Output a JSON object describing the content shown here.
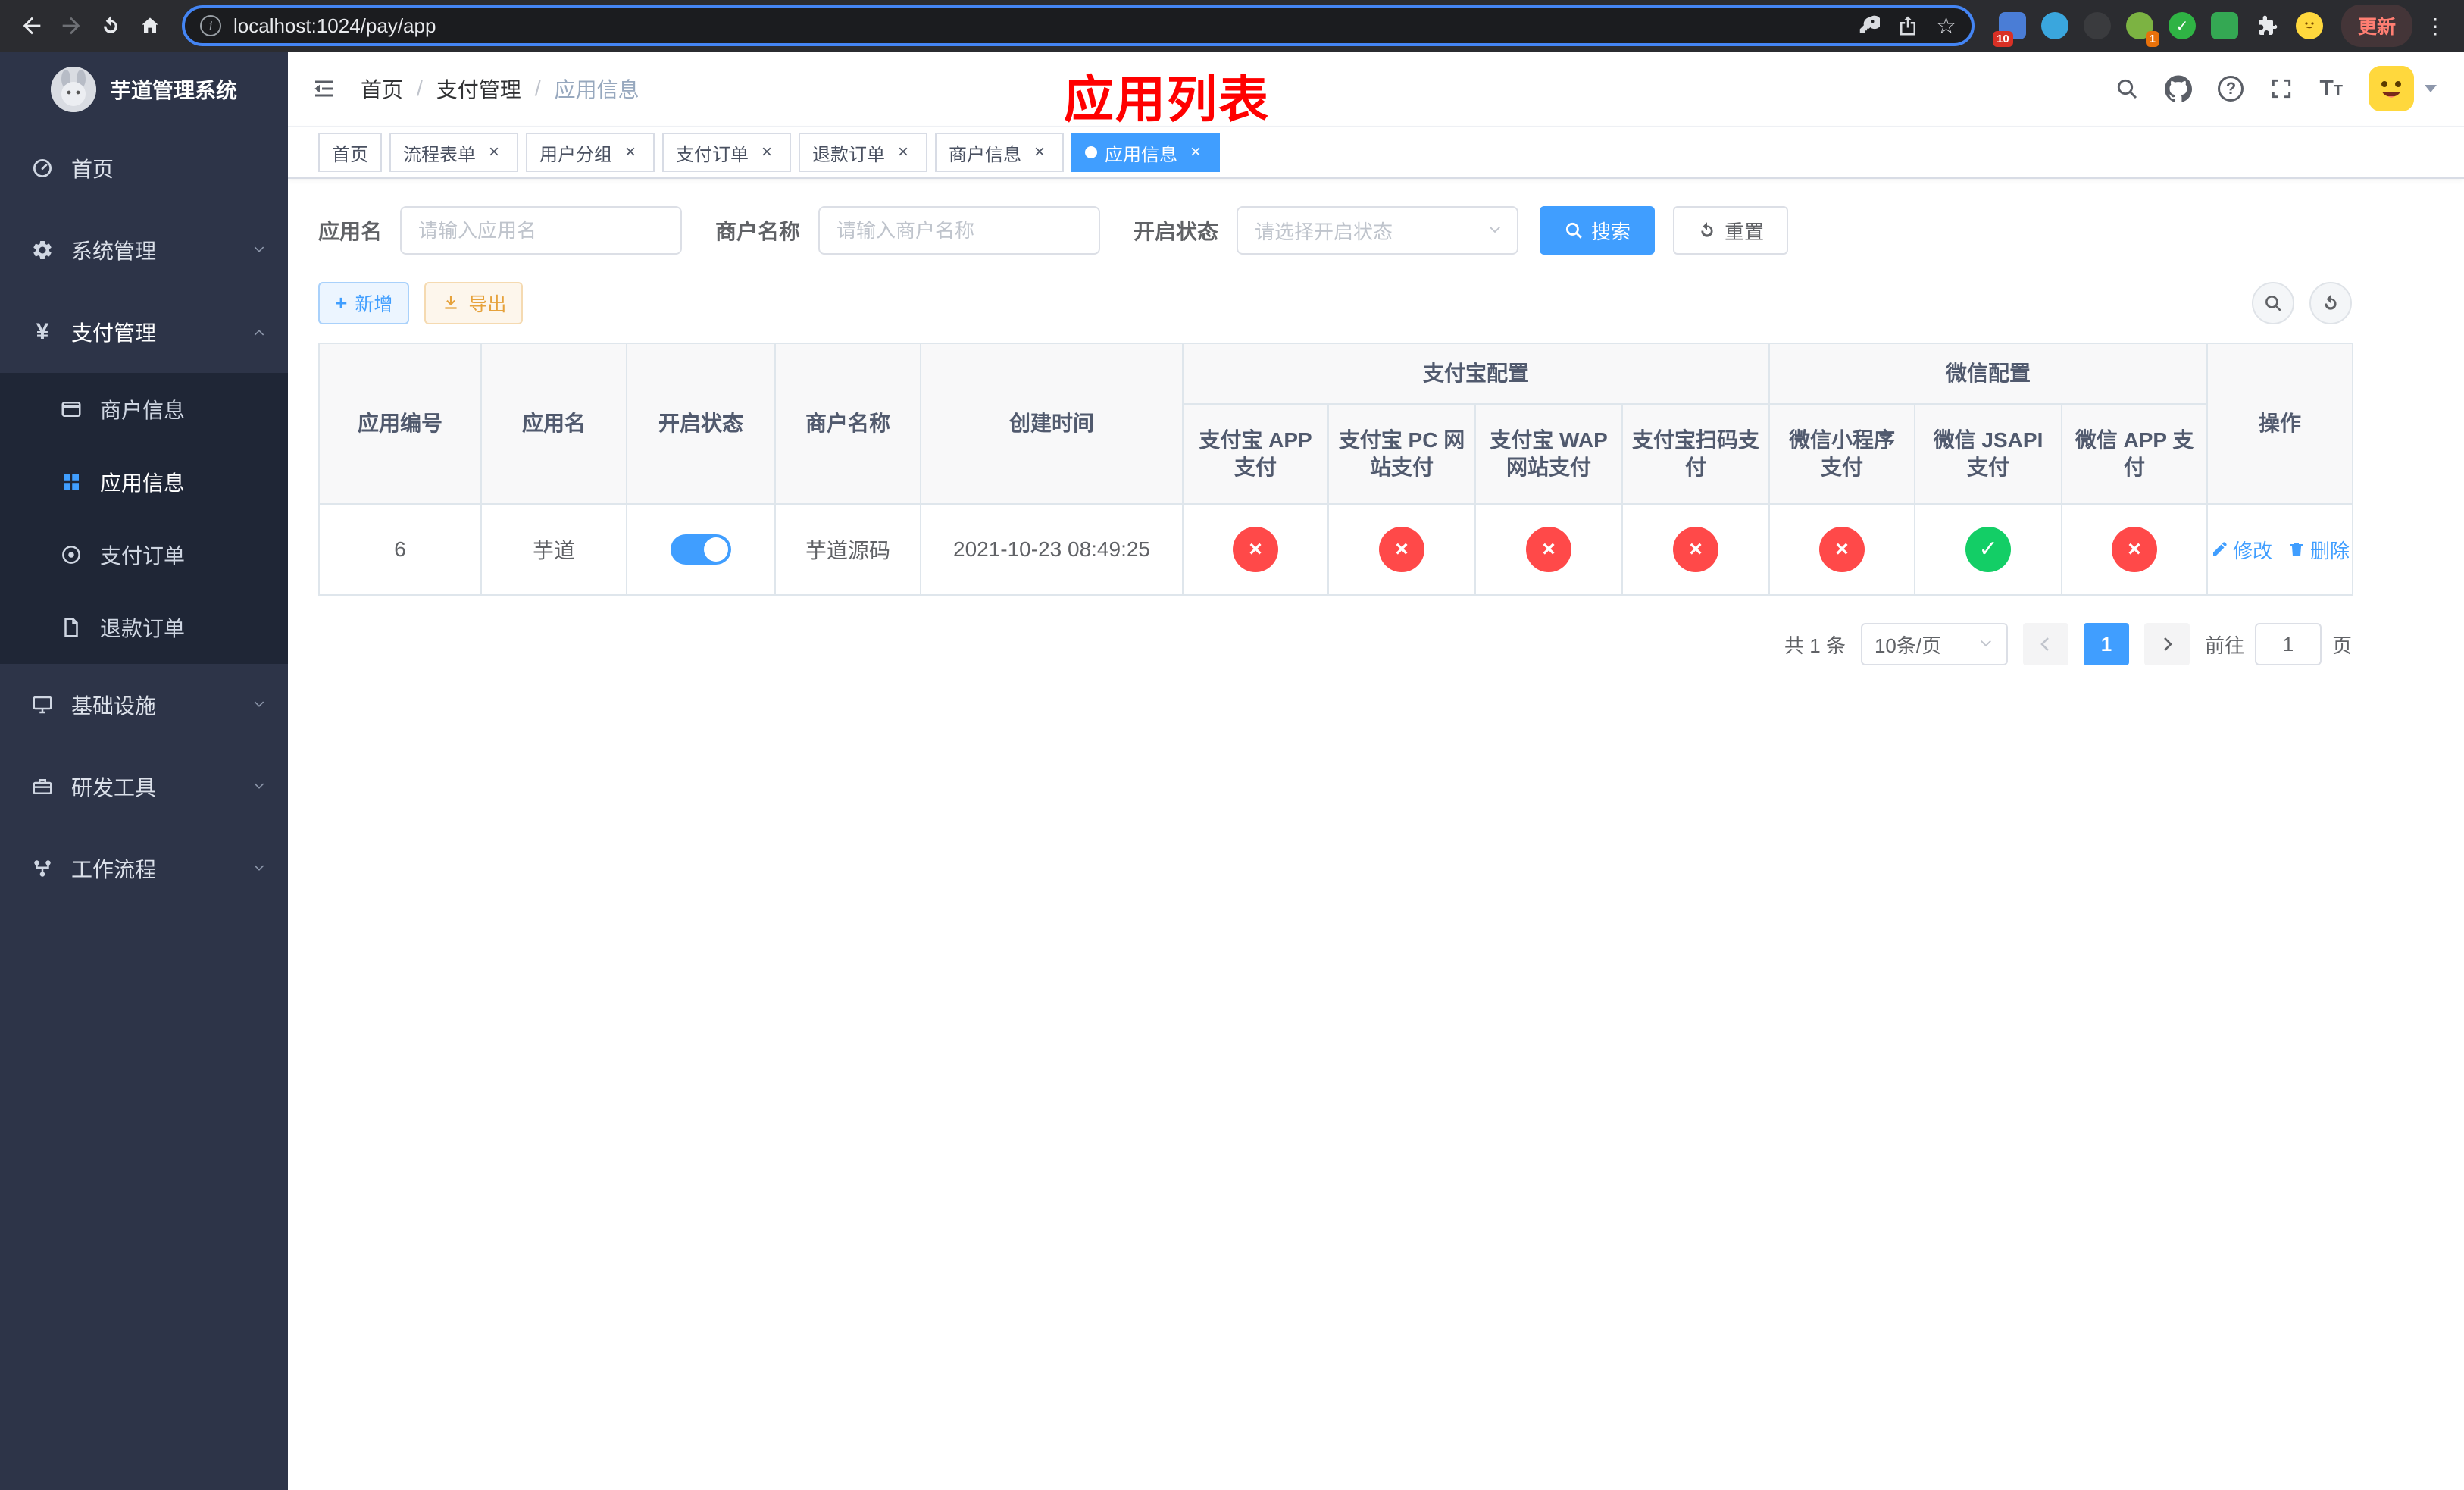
{
  "browser": {
    "url": "localhost:1024/pay/app",
    "update_label": "更新",
    "badge_apps": "10",
    "badge_avatar": "1"
  },
  "icons": {
    "close": "×",
    "cross": "×",
    "check": "✓",
    "plus": "+",
    "dots_vertical": "⋮",
    "star": "☆",
    "info": "i",
    "question": "?",
    "yen": "¥",
    "font_big": "T",
    "font_small": "T"
  },
  "sidebar": {
    "title": "芋道管理系统",
    "items": [
      {
        "label": "首页"
      },
      {
        "label": "系统管理"
      },
      {
        "label": "支付管理"
      },
      {
        "label": "基础设施"
      },
      {
        "label": "研发工具"
      },
      {
        "label": "工作流程"
      }
    ],
    "submenu": [
      {
        "label": "商户信息"
      },
      {
        "label": "应用信息"
      },
      {
        "label": "支付订单"
      },
      {
        "label": "退款订单"
      }
    ]
  },
  "navbar": {
    "breadcrumb": [
      "首页",
      "支付管理",
      "应用信息"
    ],
    "page_title": "应用列表"
  },
  "tabs": [
    {
      "label": "首页"
    },
    {
      "label": "流程表单"
    },
    {
      "label": "用户分组"
    },
    {
      "label": "支付订单"
    },
    {
      "label": "退款订单"
    },
    {
      "label": "商户信息"
    },
    {
      "label": "应用信息"
    }
  ],
  "filters": {
    "app_name_label": "应用名",
    "app_name_placeholder": "请输入应用名",
    "merchant_label": "商户名称",
    "merchant_placeholder": "请输入商户名称",
    "status_label": "开启状态",
    "status_placeholder": "请选择开启状态",
    "search_label": "搜索",
    "reset_label": "重置"
  },
  "toolbar": {
    "add_label": "新增",
    "export_label": "导出"
  },
  "table": {
    "columns": {
      "id": "应用编号",
      "name": "应用名",
      "status": "开启状态",
      "merchant": "商户名称",
      "created": "创建时间",
      "actions": "操作"
    },
    "groups": {
      "alipay": "支付宝配置",
      "wechat": "微信配置"
    },
    "sub_columns": [
      "支付宝 APP 支付",
      "支付宝 PC 网站支付",
      "支付宝 WAP 网站支付",
      "支付宝扫码支付",
      "微信小程序支付",
      "微信 JSAPI 支付",
      "微信 APP 支付"
    ],
    "row": {
      "id": "6",
      "name": "芋道",
      "status_on": true,
      "merchant": "芋道源码",
      "created": "2021-10-23 08:49:25",
      "pay_channels": [
        "disabled",
        "disabled",
        "disabled",
        "disabled",
        "disabled",
        "enabled",
        "disabled"
      ],
      "edit_label": "修改",
      "delete_label": "删除"
    }
  },
  "pagination": {
    "total_text": "共 1 条",
    "page_size": "10条/页",
    "current_page": "1",
    "goto_prefix": "前往",
    "goto_value": "1",
    "goto_suffix": "页"
  },
  "colors": {
    "primary": "#409EFF",
    "success": "#13ce66",
    "danger": "#ff4949",
    "title_red": "#ff0000",
    "sidebar_bg": "#2d3448",
    "submenu_bg": "#1f2636"
  }
}
